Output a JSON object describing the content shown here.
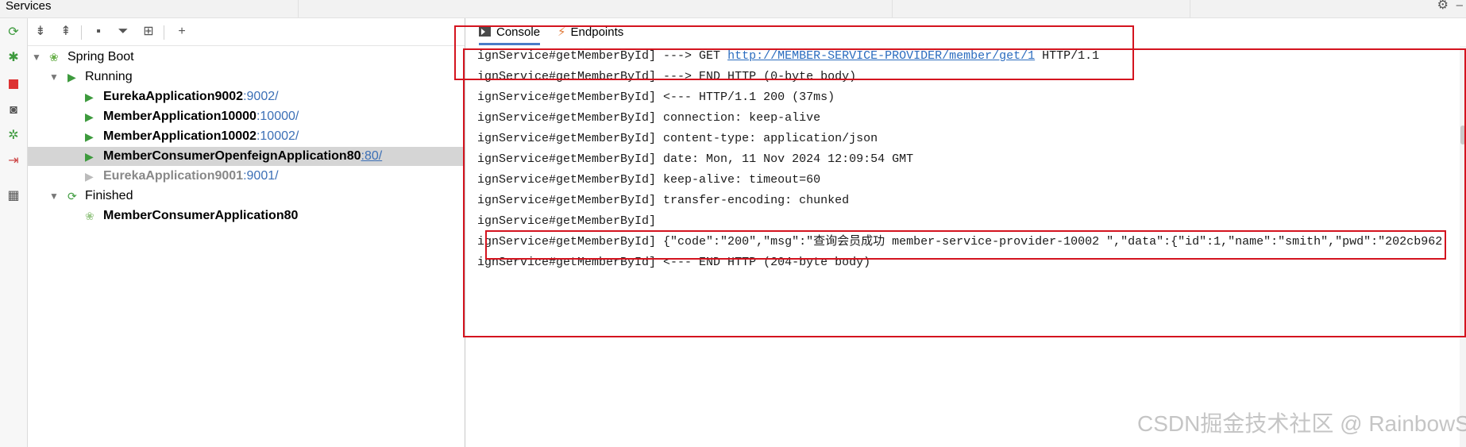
{
  "window": {
    "title": "Services"
  },
  "left_toolbar": {
    "icons": [
      "refresh-icon",
      "debug-icon",
      "stop-icon",
      "camera-icon",
      "bug-restart-icon",
      "exit-icon",
      "layout-icon"
    ]
  },
  "tree_toolbar": {
    "icons": [
      "expand-all-icon",
      "collapse-all-icon",
      "group-icon",
      "filter-icon",
      "new-tab-icon",
      "add-icon"
    ]
  },
  "tree": {
    "root": {
      "label": "Spring Boot"
    },
    "running": {
      "label": "Running"
    },
    "running_items": [
      {
        "name": "EurekaApplication9002",
        "port": ":9002/",
        "state": "running"
      },
      {
        "name": "MemberApplication10000",
        "port": ":10000/",
        "state": "running"
      },
      {
        "name": "MemberApplication10002",
        "port": ":10002/",
        "state": "running"
      },
      {
        "name": "MemberConsumerOpenfeignApplication80",
        "port": ":80/",
        "state": "selected"
      },
      {
        "name": "EurekaApplication9001",
        "port": ":9001/",
        "state": "inactive"
      }
    ],
    "finished": {
      "label": "Finished"
    },
    "finished_items": [
      {
        "name": "MemberConsumerApplication80"
      }
    ]
  },
  "tabs": [
    {
      "label": "Console",
      "active": true
    },
    {
      "label": "Endpoints",
      "active": false
    }
  ],
  "console": {
    "prefix": "ignService#getMemberById]",
    "lines": [
      {
        "rest": " ---> GET ",
        "link": "http://MEMBER-SERVICE-PROVIDER/member/get/1",
        "tail": " HTTP/1.1"
      },
      {
        "rest": " ---> END HTTP (0-byte body)"
      },
      {
        "rest": " <--- HTTP/1.1 200 (37ms)"
      },
      {
        "rest": " connection: keep-alive"
      },
      {
        "rest": " content-type: application/json"
      },
      {
        "rest": " date: Mon, 11 Nov 2024 12:09:54 GMT"
      },
      {
        "rest": " keep-alive: timeout=60"
      },
      {
        "rest": " transfer-encoding: chunked"
      },
      {
        "rest": ""
      },
      {
        "rest": " {\"code\":\"200\",\"msg\":\"查询会员成功 member-service-provider-10002 \",\"data\":{\"id\":1,\"name\":\"smith\",\"pwd\":\"202cb962"
      },
      {
        "rest": " <--- END HTTP (204-byte body)"
      }
    ]
  },
  "watermark": "CSDN掘金技术社区 @ RainbowSea",
  "colors": {
    "annotation_red": "#d4141f",
    "link_blue": "#2b6cbf",
    "selection_grey": "#d5d5d5",
    "run_green": "#3d9a3d"
  }
}
